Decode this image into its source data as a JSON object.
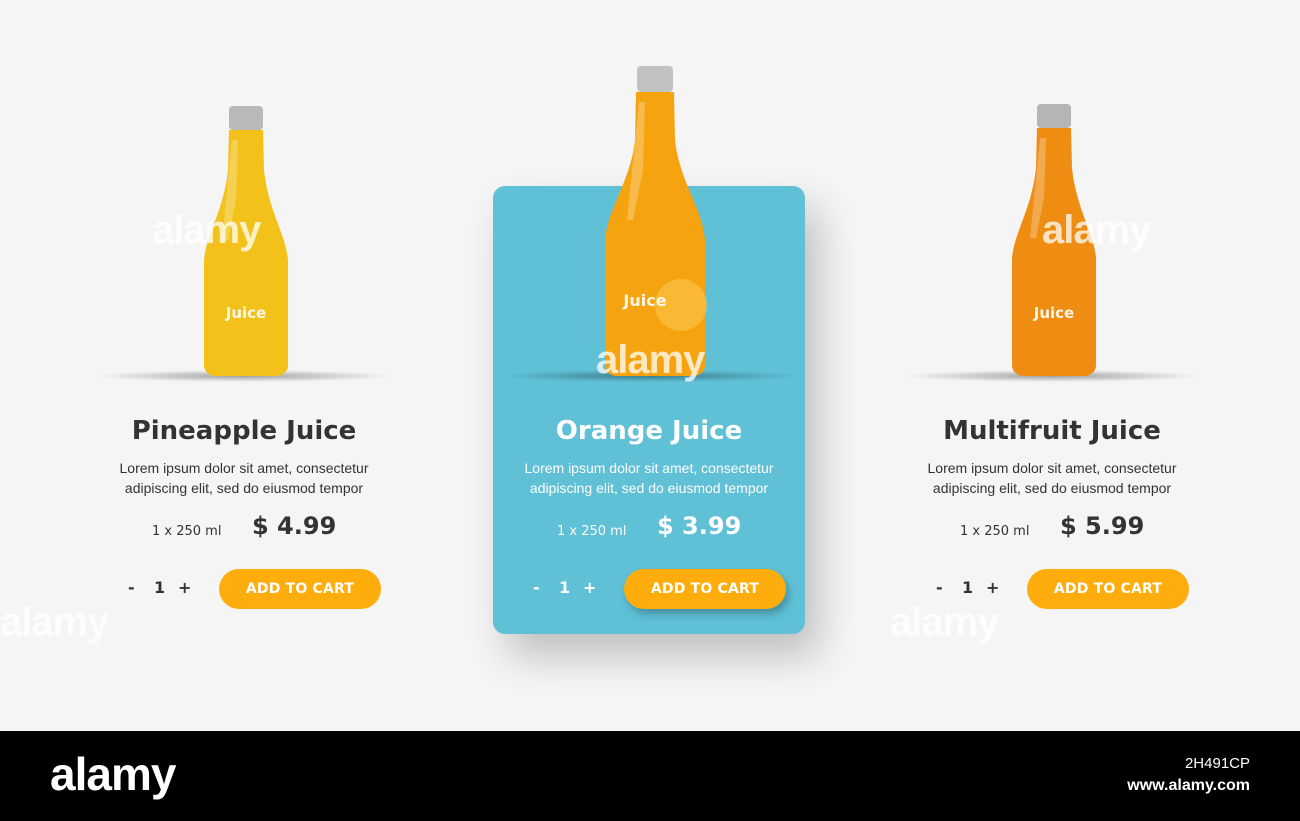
{
  "products": [
    {
      "title": "Pineapple Juice",
      "description": "Lorem ipsum dolor sit amet, consectetur adipiscing elit, sed do eiusmod tempor",
      "volume": "1 x 250 ml",
      "price": "$ 4.99",
      "qty_minus": "-",
      "qty_value": "1",
      "qty_plus": "+",
      "cart_label": "ADD TO CART",
      "bottle_label": "Juice",
      "liquid_color": "#f2c21a"
    },
    {
      "title": "Orange Juice",
      "description": "Lorem ipsum dolor sit amet, consectetur adipiscing elit, sed do eiusmod tempor",
      "volume": "1 x 250 ml",
      "price": "$ 3.99",
      "qty_minus": "-",
      "qty_value": "1",
      "qty_plus": "+",
      "cart_label": "ADD TO CART",
      "bottle_label": "Juice",
      "liquid_color": "#f5a30f",
      "highlighted": true,
      "panel_color": "#5fc0d6"
    },
    {
      "title": "Multifruit Juice",
      "description": "Lorem ipsum dolor sit amet, consectetur adipiscing elit, sed do eiusmod tempor",
      "volume": "1 x 250 ml",
      "price": "$ 5.99",
      "qty_minus": "-",
      "qty_value": "1",
      "qty_plus": "+",
      "cart_label": "ADD TO CART",
      "bottle_label": "Juice",
      "liquid_color": "#ef8d12"
    }
  ],
  "colors": {
    "background": "#f5f5f5",
    "accent_button": "#ffad0d",
    "highlight_panel": "#5fc0d6",
    "text": "#333333"
  },
  "watermark": {
    "text": "alamy"
  },
  "footer": {
    "logo": "alamy",
    "image_id": "2H491CP",
    "url": "www.alamy.com"
  }
}
